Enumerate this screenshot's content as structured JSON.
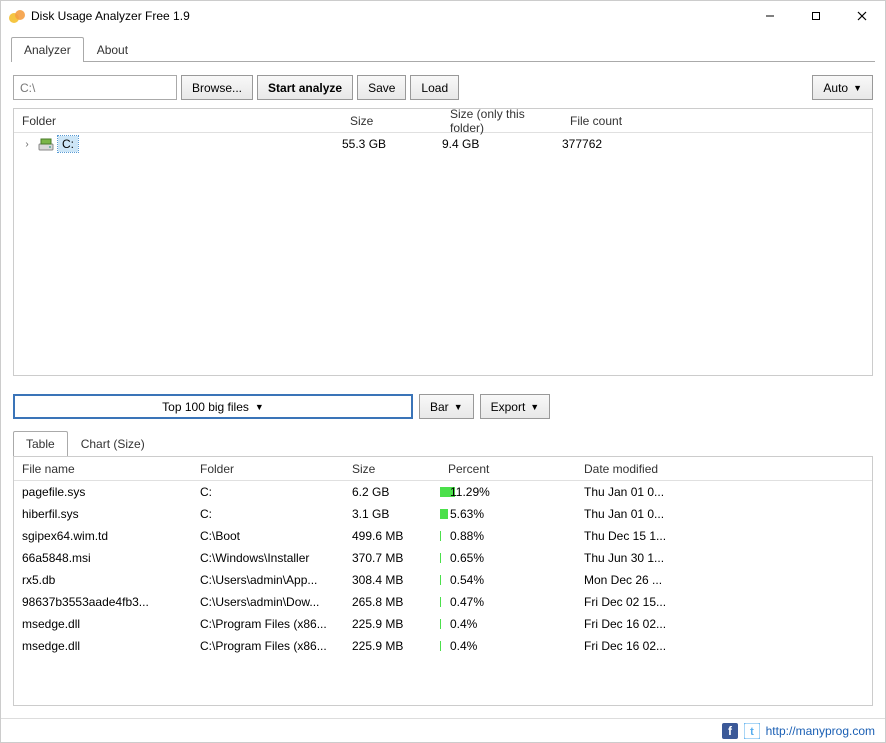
{
  "window": {
    "title": "Disk Usage Analyzer Free 1.9"
  },
  "tabs": {
    "analyzer": "Analyzer",
    "about": "About"
  },
  "toolbar": {
    "path": "C:\\",
    "browse": "Browse...",
    "start": "Start analyze",
    "save": "Save",
    "load": "Load",
    "auto": "Auto"
  },
  "tree": {
    "headers": {
      "folder": "Folder",
      "size": "Size",
      "sizeonly": "Size (only this folder)",
      "count": "File count"
    },
    "rows": [
      {
        "label": "C:",
        "size": "55.3 GB",
        "sizeonly": "9.4 GB",
        "count": "377762"
      }
    ]
  },
  "mid": {
    "top100": "Top 100 big files",
    "bar": "Bar",
    "export": "Export"
  },
  "subtabs": {
    "table": "Table",
    "chart": "Chart (Size)"
  },
  "files": {
    "headers": {
      "name": "File name",
      "folder": "Folder",
      "size": "Size",
      "percent": "Percent",
      "date": "Date modified"
    },
    "rows": [
      {
        "name": "pagefile.sys",
        "folder": "C:",
        "size": "6.2 GB",
        "percent": "11.29%",
        "pct": 11.29,
        "date": "Thu Jan 01 0..."
      },
      {
        "name": "hiberfil.sys",
        "folder": "C:",
        "size": "3.1 GB",
        "percent": "5.63%",
        "pct": 5.63,
        "date": "Thu Jan 01 0..."
      },
      {
        "name": "sgipex64.wim.td",
        "folder": "C:\\Boot",
        "size": "499.6 MB",
        "percent": "0.88%",
        "pct": 0.88,
        "date": "Thu Dec 15 1..."
      },
      {
        "name": "66a5848.msi",
        "folder": "C:\\Windows\\Installer",
        "size": "370.7 MB",
        "percent": "0.65%",
        "pct": 0.65,
        "date": "Thu Jun 30 1..."
      },
      {
        "name": "rx5.db",
        "folder": "C:\\Users\\admin\\App...",
        "size": "308.4 MB",
        "percent": "0.54%",
        "pct": 0.54,
        "date": "Mon Dec 26 ..."
      },
      {
        "name": "98637b3553aade4fb3...",
        "folder": "C:\\Users\\admin\\Dow...",
        "size": "265.8 MB",
        "percent": "0.47%",
        "pct": 0.47,
        "date": "Fri Dec 02 15..."
      },
      {
        "name": "msedge.dll",
        "folder": "C:\\Program Files (x86...",
        "size": "225.9 MB",
        "percent": "0.4%",
        "pct": 0.4,
        "date": "Fri Dec 16 02..."
      },
      {
        "name": "msedge.dll",
        "folder": "C:\\Program Files (x86...",
        "size": "225.9 MB",
        "percent": "0.4%",
        "pct": 0.4,
        "date": "Fri Dec 16 02..."
      }
    ]
  },
  "footer": {
    "url": "http://manyprog.com"
  }
}
